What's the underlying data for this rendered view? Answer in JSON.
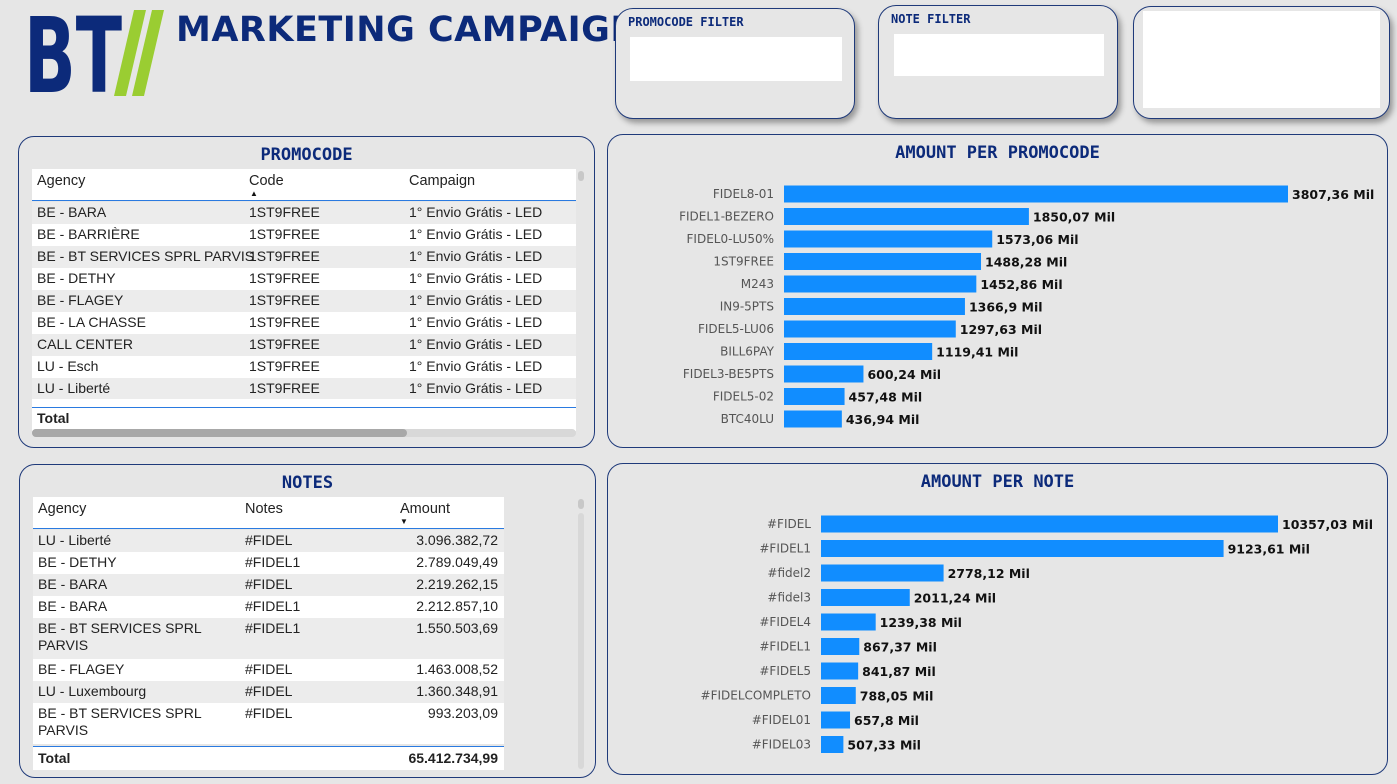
{
  "header": {
    "logo_text": "BT",
    "title": "MARKETING CAMPAIGNS"
  },
  "filters": {
    "promocode": {
      "title": "PROMOCODE FILTER"
    },
    "note": {
      "title": "NOTE FILTER"
    }
  },
  "promocode_table": {
    "title": "PROMOCODE",
    "columns": [
      "Agency",
      "Code",
      "Campaign"
    ],
    "rows": [
      [
        "BE - BARA",
        "1ST9FREE",
        "1° Envio Grátis - LED"
      ],
      [
        "BE - BARRIÈRE",
        "1ST9FREE",
        "1° Envio Grátis - LED"
      ],
      [
        "BE - BT SERVICES SPRL PARVIS",
        "1ST9FREE",
        "1° Envio Grátis - LED"
      ],
      [
        "BE - DETHY",
        "1ST9FREE",
        "1° Envio Grátis - LED"
      ],
      [
        "BE - FLAGEY",
        "1ST9FREE",
        "1° Envio Grátis - LED"
      ],
      [
        "BE - LA CHASSE",
        "1ST9FREE",
        "1° Envio Grátis - LED"
      ],
      [
        "CALL CENTER",
        "1ST9FREE",
        "1° Envio Grátis - LED"
      ],
      [
        "LU - Esch",
        "1ST9FREE",
        "1° Envio Grátis - LED"
      ],
      [
        "LU - Liberté",
        "1ST9FREE",
        "1° Envio Grátis - LED"
      ]
    ],
    "total_label": "Total"
  },
  "notes_table": {
    "title": "NOTES",
    "columns": [
      "Agency",
      "Notes",
      "Amount"
    ],
    "rows": [
      [
        "LU - Liberté",
        "#FIDEL",
        "3.096.382,72"
      ],
      [
        "BE - DETHY",
        "#FIDEL1",
        "2.789.049,49"
      ],
      [
        "BE - BARA",
        "#FIDEL",
        "2.219.262,15"
      ],
      [
        "BE - BARA",
        "#FIDEL1",
        "2.212.857,10"
      ],
      [
        "BE - BT SERVICES SPRL PARVIS",
        "#FIDEL1",
        "1.550.503,69"
      ],
      [
        "BE - FLAGEY",
        "#FIDEL",
        "1.463.008,52"
      ],
      [
        "LU - Luxembourg",
        "#FIDEL",
        "1.360.348,91"
      ],
      [
        "BE - BT SERVICES SPRL PARVIS",
        "#FIDEL",
        "993.203,09"
      ]
    ],
    "total_label": "Total",
    "total_value": "65.412.734,99"
  },
  "colors": {
    "bar": "#118dff",
    "title": "#0c2a7a",
    "logo_green": "#9acd32"
  },
  "chart_data": [
    {
      "type": "bar",
      "orientation": "horizontal",
      "title": "AMOUNT PER PROMOCODE",
      "categories": [
        "FIDEL8-01",
        "FIDEL1-BEZERO",
        "FIDEL0-LU50%",
        "1ST9FREE",
        "M243",
        "IN9-5PTS",
        "FIDEL5-LU06",
        "BILL6PAY",
        "FIDEL3-BE5PTS",
        "FIDEL5-02",
        "BTC40LU"
      ],
      "values": [
        3807.36,
        1850.07,
        1573.06,
        1488.28,
        1452.86,
        1366.9,
        1297.63,
        1119.41,
        600.24,
        457.48,
        436.94
      ],
      "data_labels": [
        "3807,36 Mil",
        "1850,07 Mil",
        "1573,06 Mil",
        "1488,28 Mil",
        "1452,86 Mil",
        "1366,9 Mil",
        "1297,63 Mil",
        "1119,41 Mil",
        "600,24 Mil",
        "457,48 Mil",
        "436,94 Mil"
      ],
      "xlim": [
        0,
        3807.36
      ]
    },
    {
      "type": "bar",
      "orientation": "horizontal",
      "title": "AMOUNT PER NOTE",
      "categories": [
        "#FIDEL",
        "#FIDEL1",
        "#fidel2",
        "#fidel3",
        "#FIDEL4",
        "#FIDEL1",
        "#FIDEL5",
        "#FIDELCOMPLETO",
        "#FIDEL01",
        "#FIDEL03"
      ],
      "values": [
        10357.03,
        9123.61,
        2778.12,
        2011.24,
        1239.38,
        867.37,
        841.87,
        788.05,
        657.8,
        507.33
      ],
      "data_labels": [
        "10357,03 Mil",
        "9123,61 Mil",
        "2778,12 Mil",
        "2011,24 Mil",
        "1239,38 Mil",
        "867,37 Mil",
        "841,87 Mil",
        "788,05 Mil",
        "657,8 Mil",
        "507,33 Mil"
      ],
      "xlim": [
        0,
        10357.03
      ]
    }
  ]
}
